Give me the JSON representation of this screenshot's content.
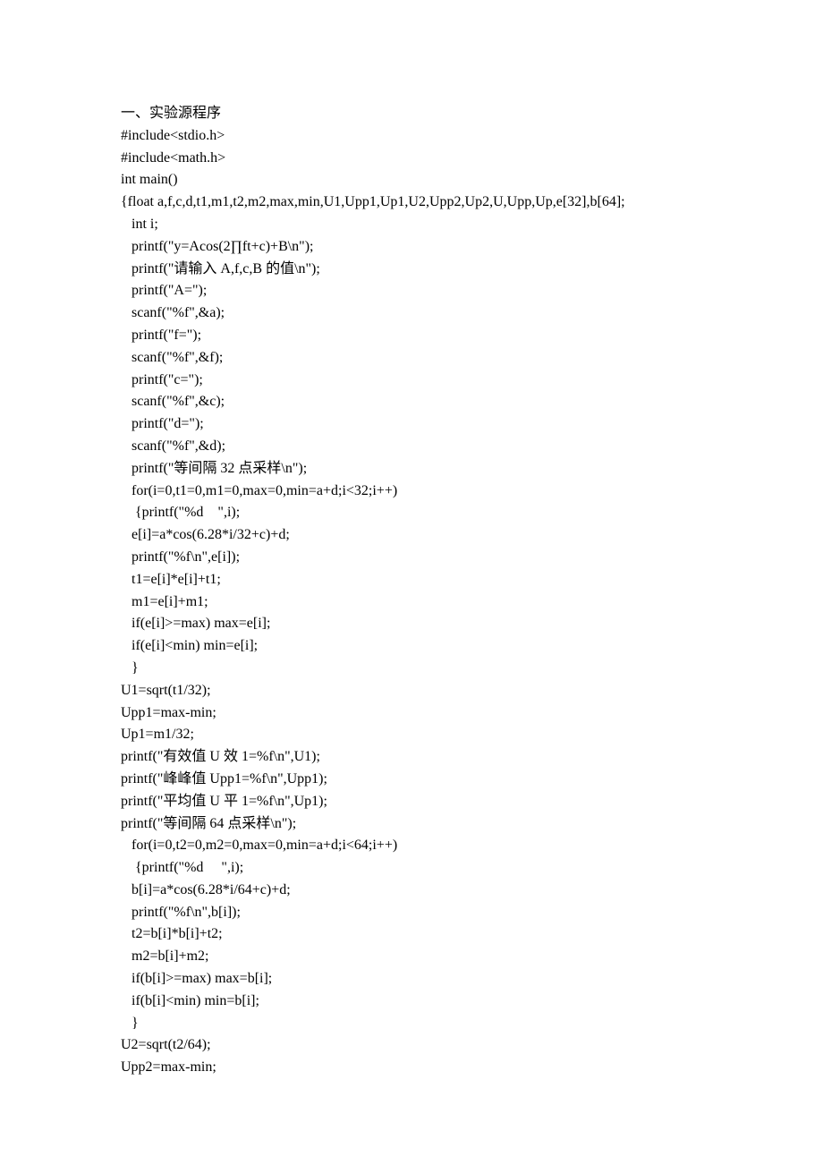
{
  "lines": [
    {
      "text": "一、实验源程序",
      "indent": 0
    },
    {
      "text": "#include<stdio.h>",
      "indent": 0
    },
    {
      "text": "#include<math.h>",
      "indent": 0
    },
    {
      "text": "int main()",
      "indent": 0
    },
    {
      "text": "{float a,f,c,d,t1,m1,t2,m2,max,min,U1,Upp1,Up1,U2,Upp2,Up2,U,Upp,Up,e[32],b[64];",
      "indent": 0
    },
    {
      "text": "int i;",
      "indent": 1
    },
    {
      "text": "printf(\"y=Acos(2∏ft+c)+B\\n\");",
      "indent": 1
    },
    {
      "text": "printf(\"请输入 A,f,c,B 的值\\n\");",
      "indent": 1
    },
    {
      "text": "printf(\"A=\");",
      "indent": 1
    },
    {
      "text": "scanf(\"%f\",&a);",
      "indent": 1
    },
    {
      "text": "printf(\"f=\");",
      "indent": 1
    },
    {
      "text": "scanf(\"%f\",&f);",
      "indent": 1
    },
    {
      "text": "printf(\"c=\");",
      "indent": 1
    },
    {
      "text": "scanf(\"%f\",&c);",
      "indent": 1
    },
    {
      "text": "printf(\"d=\");",
      "indent": 1
    },
    {
      "text": "scanf(\"%f\",&d);",
      "indent": 1
    },
    {
      "text": "printf(\"等间隔 32 点采样\\n\");",
      "indent": 1
    },
    {
      "text": "for(i=0,t1=0,m1=0,max=0,min=a+d;i<32;i++)",
      "indent": 1
    },
    {
      "text": " {printf(\"%d    \",i);",
      "indent": 1
    },
    {
      "text": "e[i]=a*cos(6.28*i/32+c)+d;",
      "indent": 1
    },
    {
      "text": "printf(\"%f\\n\",e[i]);",
      "indent": 1
    },
    {
      "text": "t1=e[i]*e[i]+t1;",
      "indent": 1
    },
    {
      "text": "m1=e[i]+m1;",
      "indent": 1
    },
    {
      "text": "if(e[i]>=max) max=e[i];",
      "indent": 1
    },
    {
      "text": "if(e[i]<min) min=e[i];",
      "indent": 1
    },
    {
      "text": "}",
      "indent": 1
    },
    {
      "text": "U1=sqrt(t1/32);",
      "indent": 0
    },
    {
      "text": "Upp1=max-min;",
      "indent": 0
    },
    {
      "text": "Up1=m1/32;",
      "indent": 0
    },
    {
      "text": "printf(\"有效值 U 效 1=%f\\n\",U1);",
      "indent": 0
    },
    {
      "text": "printf(\"峰峰值 Upp1=%f\\n\",Upp1);",
      "indent": 0
    },
    {
      "text": "printf(\"平均值 U 平 1=%f\\n\",Up1);",
      "indent": 0
    },
    {
      "text": "printf(\"等间隔 64 点采样\\n\");",
      "indent": 0
    },
    {
      "text": "for(i=0,t2=0,m2=0,max=0,min=a+d;i<64;i++)",
      "indent": 1
    },
    {
      "text": " {printf(\"%d     \",i);",
      "indent": 1
    },
    {
      "text": "b[i]=a*cos(6.28*i/64+c)+d;",
      "indent": 1
    },
    {
      "text": "printf(\"%f\\n\",b[i]);",
      "indent": 1
    },
    {
      "text": "t2=b[i]*b[i]+t2;",
      "indent": 1
    },
    {
      "text": "m2=b[i]+m2;",
      "indent": 1
    },
    {
      "text": "if(b[i]>=max) max=b[i];",
      "indent": 1
    },
    {
      "text": "if(b[i]<min) min=b[i];",
      "indent": 1
    },
    {
      "text": "}",
      "indent": 1
    },
    {
      "text": "U2=sqrt(t2/64);",
      "indent": 0
    },
    {
      "text": "Upp2=max-min;",
      "indent": 0
    }
  ]
}
